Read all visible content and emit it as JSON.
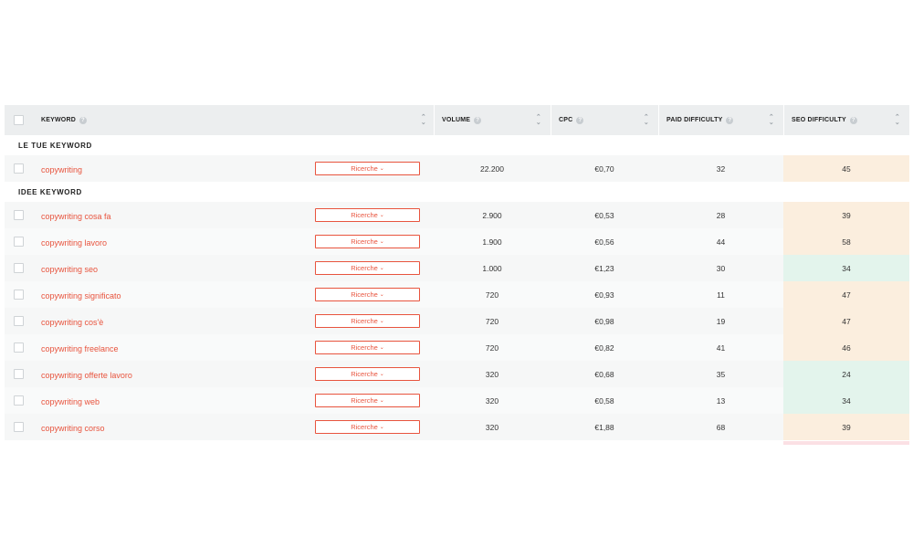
{
  "header": {
    "keyword": "KEYWORD",
    "volume": "VOLUME",
    "cpc": "CPC",
    "paid_difficulty": "PAID DIFFICULTY",
    "seo_difficulty": "SEO DIFFICULTY"
  },
  "icons": {
    "help": "help-icon",
    "sort": "sort-icon",
    "chevron": "chevron-down-icon"
  },
  "colors": {
    "accent": "#e8543e",
    "seo_medium": "#fbeede",
    "seo_easy": "#e3f4ec"
  },
  "sections": {
    "yours": "LE TUE KEYWORD",
    "ideas": "IDEE KEYWORD"
  },
  "button_label": "Ricerche",
  "your_rows": [
    {
      "keyword": "copywriting",
      "volume": "22.200",
      "cpc": "€0,70",
      "paid": "32",
      "seo": "45",
      "seo_level": "medium"
    }
  ],
  "idea_rows": [
    {
      "keyword": "copywriting cosa fa",
      "volume": "2.900",
      "cpc": "€0,53",
      "paid": "28",
      "seo": "39",
      "seo_level": "medium"
    },
    {
      "keyword": "copywriting lavoro",
      "volume": "1.900",
      "cpc": "€0,56",
      "paid": "44",
      "seo": "58",
      "seo_level": "medium"
    },
    {
      "keyword": "copywriting seo",
      "volume": "1.000",
      "cpc": "€1,23",
      "paid": "30",
      "seo": "34",
      "seo_level": "easy"
    },
    {
      "keyword": "copywriting significato",
      "volume": "720",
      "cpc": "€0,93",
      "paid": "11",
      "seo": "47",
      "seo_level": "medium"
    },
    {
      "keyword": "copywriting cos'è",
      "volume": "720",
      "cpc": "€0,98",
      "paid": "19",
      "seo": "47",
      "seo_level": "medium"
    },
    {
      "keyword": "copywriting freelance",
      "volume": "720",
      "cpc": "€0,82",
      "paid": "41",
      "seo": "46",
      "seo_level": "medium"
    },
    {
      "keyword": "copywriting offerte lavoro",
      "volume": "320",
      "cpc": "€0,68",
      "paid": "35",
      "seo": "24",
      "seo_level": "easy"
    },
    {
      "keyword": "copywriting web",
      "volume": "320",
      "cpc": "€0,58",
      "paid": "13",
      "seo": "34",
      "seo_level": "easy"
    },
    {
      "keyword": "copywriting corso",
      "volume": "320",
      "cpc": "€1,88",
      "paid": "68",
      "seo": "39",
      "seo_level": "medium"
    }
  ]
}
